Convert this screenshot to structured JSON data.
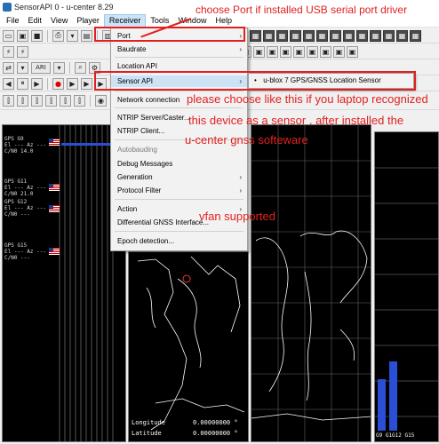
{
  "window": {
    "title": "SensorAPI 0 - u-center 8.29"
  },
  "menubar": {
    "items": [
      "File",
      "Edit",
      "View",
      "Player",
      "Receiver",
      "Tools",
      "Window",
      "Help"
    ],
    "active": "Receiver"
  },
  "toolbar": {
    "row2_label": "ARI"
  },
  "receiver_menu": {
    "items": [
      {
        "label": "Port",
        "submenu": true,
        "state": "normal"
      },
      {
        "label": "Baudrate",
        "submenu": true,
        "state": "normal"
      },
      {
        "label": "Location API",
        "submenu": false,
        "state": "normal"
      },
      {
        "label": "Sensor API",
        "submenu": true,
        "state": "hover"
      },
      {
        "label": "Network connection",
        "submenu": false,
        "state": "normal"
      },
      {
        "label": "NTRIP Server/Caster...",
        "submenu": false,
        "state": "normal"
      },
      {
        "label": "NTRIP Client...",
        "submenu": false,
        "state": "normal"
      },
      {
        "label": "Autobauding",
        "submenu": false,
        "state": "disabled"
      },
      {
        "label": "Debug Messages",
        "submenu": false,
        "state": "normal"
      },
      {
        "label": "Generation",
        "submenu": true,
        "state": "normal"
      },
      {
        "label": "Protocol Filter",
        "submenu": true,
        "state": "normal"
      },
      {
        "label": "Action",
        "submenu": true,
        "state": "normal"
      },
      {
        "label": "Differential GNSS Interface...",
        "submenu": false,
        "state": "normal"
      },
      {
        "label": "Epoch detection...",
        "submenu": false,
        "state": "normal"
      }
    ],
    "submenu_arrow": "›"
  },
  "sensor_submenu": {
    "bullet": "•",
    "item": "u-blox 7 GPS/GNSS Location Sensor"
  },
  "satellites": [
    {
      "text": "GPS G9\nEl --- Az ---\nC/N0 14.0"
    },
    {
      "text": "GPS G11\nEl --- Az ---\nC/N0 21.0"
    },
    {
      "text": "GPS G12\nEl --- Az ---\nC/N0 ---"
    },
    {
      "text": "GPS G15\nEl --- Az ---\nC/N0 ---"
    }
  ],
  "map_panel": {
    "longitude_label": "Longitude",
    "latitude_label": "Latitude",
    "longitude_value": "0.00000000 °",
    "latitude_value": "0.00000000 °"
  },
  "bar_panel": {
    "bottom_labels": "G9 G1G12 G15"
  },
  "annotations": {
    "note1": "choose Port if installed USB serial port driver",
    "note2": "please choose like this if you laptop recognized",
    "note3": "this device as a sensor , after installed the",
    "note4": "u-center gnss softeware",
    "note5": "vfan supported"
  },
  "colors": {
    "annotation_red": "#e32020",
    "menu_hover": "#cde2f5",
    "bar_blue": "#2a4fd6"
  }
}
